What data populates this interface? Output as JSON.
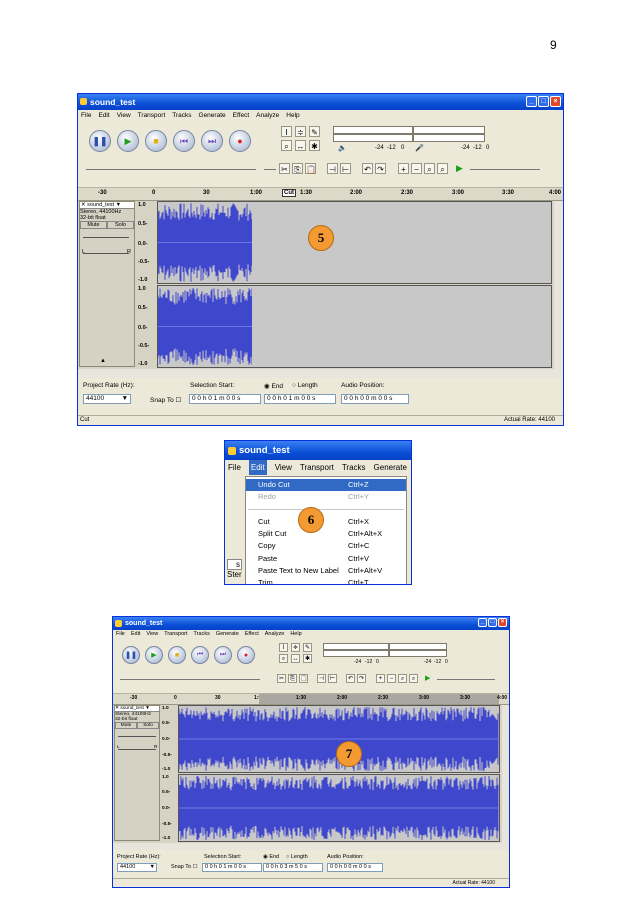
{
  "page_number": "9",
  "screenshot1": {
    "title": "sound_test",
    "menus": [
      "File",
      "Edit",
      "View",
      "Transport",
      "Tracks",
      "Generate",
      "Effect",
      "Analyze",
      "Help"
    ],
    "ruler_ticks": [
      "-30",
      "0",
      "30",
      "1:00",
      "1:30",
      "2:00",
      "2:30",
      "3:00",
      "3:30",
      "4:00"
    ],
    "cut_tooltip": "Cut",
    "track": {
      "name": "sound_test",
      "line1": "Stereo, 44100Hz",
      "line2": "32-bit float",
      "mute": "Mute",
      "solo": "Solo",
      "l": "L",
      "r": "R"
    },
    "y_axis": [
      "1.0",
      "0.5-",
      "0.0-",
      "-0.5-",
      "-1.0"
    ],
    "y_axis2": [
      "1.0",
      "0.5-",
      "0.0-",
      "-0.5-",
      "-1.0"
    ],
    "meter_labels": [
      "-24",
      "-12",
      "0"
    ],
    "project_rate_label": "Project Rate (Hz):",
    "project_rate": "44100",
    "selection_start_label": "Selection Start:",
    "end_label": "End",
    "length_label": "Length",
    "audio_position_label": "Audio Position:",
    "snap_to": "Snap To",
    "sel_start": "0 0 h 0 1 m 0 0 s",
    "sel_end": "0 0 h 0 1 m 0 0 s",
    "audio_pos": "0 0 h 0 0 m 0 0 s",
    "status_left": "Cut",
    "status_right": "Actual Rate: 44100",
    "marker": "5",
    "wave_fraction": 0.24
  },
  "screenshot2": {
    "title": "sound_test",
    "menus": [
      "File",
      "Edit",
      "View",
      "Transport",
      "Tracks",
      "Generate",
      "El"
    ],
    "items": [
      {
        "label": "Undo Cut",
        "shortcut": "Ctrl+Z",
        "state": "selected"
      },
      {
        "label": "Redo",
        "shortcut": "Ctrl+Y",
        "state": "disabled"
      },
      {
        "label": "Cut",
        "shortcut": "Ctrl+X",
        "state": "normal"
      },
      {
        "label": "Split Cut",
        "shortcut": "Ctrl+Alt+X",
        "state": "normal"
      },
      {
        "label": "Copy",
        "shortcut": "Ctrl+C",
        "state": "normal"
      },
      {
        "label": "Paste",
        "shortcut": "Ctrl+V",
        "state": "normal"
      },
      {
        "label": "Paste Text to New Label",
        "shortcut": "Ctrl+Alt+V",
        "state": "normal"
      },
      {
        "label": "Trim",
        "shortcut": "Ctrl+T",
        "state": "normal"
      }
    ],
    "side_fragments": [
      "s",
      "Ster"
    ],
    "marker": "6"
  },
  "screenshot3": {
    "title": "sound_test",
    "menus": [
      "File",
      "Edit",
      "View",
      "Transport",
      "Tracks",
      "Generate",
      "Effect",
      "Analyze",
      "Help"
    ],
    "ruler_ticks": [
      "-30",
      "0",
      "30",
      "1:00",
      "1:30",
      "2:00",
      "2:30",
      "3:00",
      "3:30",
      "4:00"
    ],
    "track": {
      "name": "sound_test",
      "line1": "Stereo, 44100Hz",
      "line2": "32-bit float",
      "mute": "Mute",
      "solo": "Solo",
      "l": "L",
      "r": "R"
    },
    "y_axis": [
      "1.0",
      "0.5-",
      "0.0-",
      "-0.5-",
      "-1.0"
    ],
    "y_axis2": [
      "1.0",
      "0.5-",
      "0.0-",
      "-0.5-",
      "-1.0"
    ],
    "meter_labels": [
      "-24",
      "-12",
      "0"
    ],
    "project_rate_label": "Project Rate (Hz):",
    "project_rate": "44100",
    "selection_start_label": "Selection Start:",
    "end_label": "End",
    "length_label": "Length",
    "audio_position_label": "Audio Position:",
    "snap_to": "Snap To",
    "sel_start": "0 0 h 0 1 m 0 0 s",
    "sel_end": "0 0 h 0 3 m 5 0 s",
    "audio_pos": "0 0 h 0 0 m 0 0 s",
    "status_right": "Actual Rate: 44100",
    "marker": "7",
    "wave_fraction": 1.0
  }
}
